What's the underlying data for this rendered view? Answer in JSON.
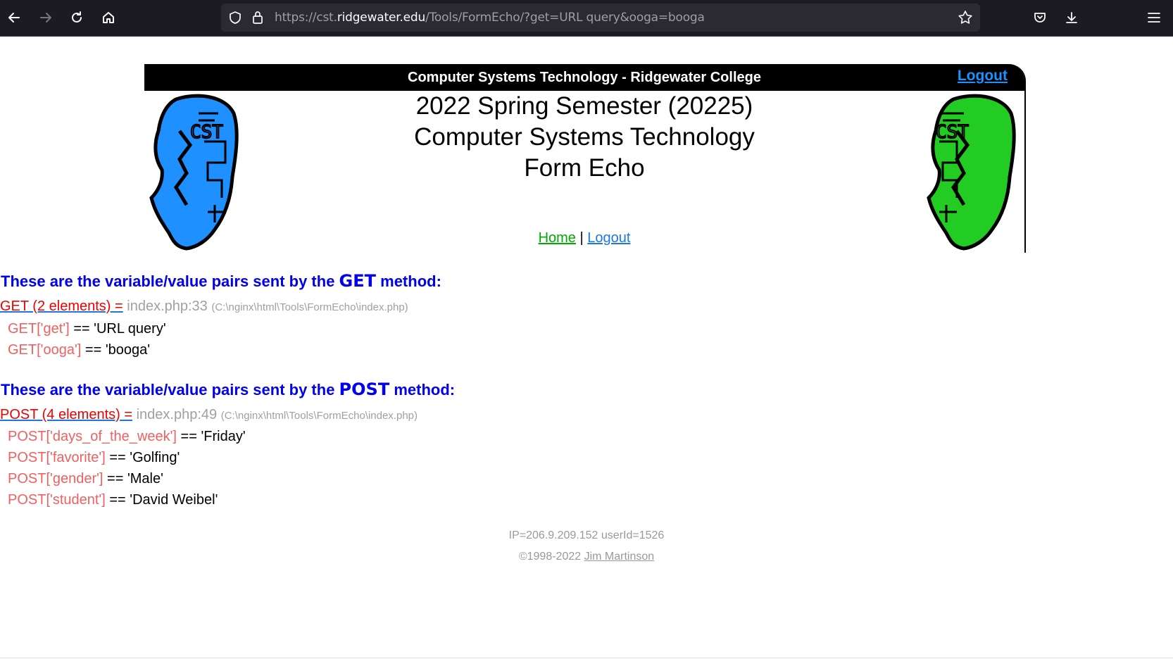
{
  "browser": {
    "url_prefix": "https://cst.",
    "url_host": "ridgewater.edu",
    "url_path": "/Tools/FormEcho/?get=URL query&ooga=booga"
  },
  "header": {
    "bar_title": "Computer Systems Technology - Ridgewater College",
    "bar_logout": "Logout",
    "title_line1": "2022 Spring Semester (20225)",
    "title_line2": "Computer Systems Technology",
    "title_line3": "Form Echo",
    "nav_home": "Home",
    "nav_sep": " | ",
    "nav_logout": "Logout",
    "logo_text": "CST"
  },
  "get_section": {
    "heading_pre": "These are the variable/value pairs sent by the ",
    "heading_method": "GET",
    "heading_post": " method:",
    "dump_label": "GET (2 elements) =",
    "dump_file": "index.php:33",
    "dump_path": "(C:\\nginx\\html\\Tools\\FormEcho\\index.php)",
    "items": [
      {
        "key": "GET['get']",
        "value": " == 'URL query'"
      },
      {
        "key": "GET['ooga']",
        "value": " == 'booga'"
      }
    ]
  },
  "post_section": {
    "heading_pre": "These are the variable/value pairs sent by the ",
    "heading_method": "POST",
    "heading_post": " method:",
    "dump_label": "POST (4 elements) =",
    "dump_file": "index.php:49",
    "dump_path": "(C:\\nginx\\html\\Tools\\FormEcho\\index.php)",
    "items": [
      {
        "key": "POST['days_of_the_week']",
        "value": " == 'Friday'"
      },
      {
        "key": "POST['favorite']",
        "value": " == 'Golfing'"
      },
      {
        "key": "POST['gender']",
        "value": " == 'Male'"
      },
      {
        "key": "POST['student']",
        "value": " == 'David Weibel'"
      }
    ]
  },
  "footer": {
    "ip_line": "IP=206.9.209.152 userId=1526",
    "copyright": "©1998-2022 ",
    "author": "Jim Martinson"
  },
  "colors": {
    "logo_left": "#1e90ff",
    "logo_right": "#22cc22",
    "heading": "#0000ee",
    "dump_label": "#ee0000",
    "key": "#f06060"
  }
}
